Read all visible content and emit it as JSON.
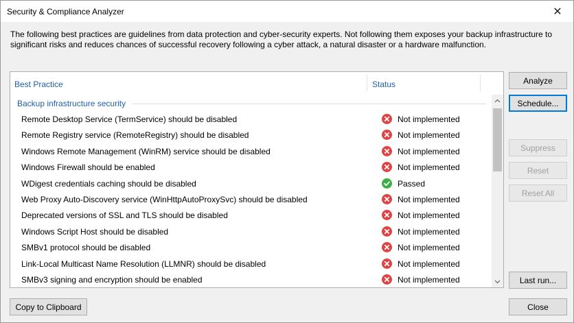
{
  "window": {
    "title": "Security & Compliance Analyzer",
    "close_glyph": "✕"
  },
  "intro": "The following best practices are guidelines from data protection and cyber-security experts. Not following them exposes your backup infrastructure to significant risks and reduces chances of successful recovery following a cyber attack, a natural disaster or a hardware malfunction.",
  "table": {
    "headers": {
      "practice": "Best Practice",
      "status": "Status"
    },
    "group": "Backup infrastructure security",
    "rows": [
      {
        "practice": "Remote Desktop Service (TermService) should be disabled",
        "status": "Not implemented",
        "icon": "error-icon"
      },
      {
        "practice": "Remote Registry service (RemoteRegistry) should be disabled",
        "status": "Not implemented",
        "icon": "error-icon"
      },
      {
        "practice": "Windows Remote Management (WinRM) service should be disabled",
        "status": "Not implemented",
        "icon": "error-icon"
      },
      {
        "practice": "Windows Firewall should be enabled",
        "status": "Not implemented",
        "icon": "error-icon"
      },
      {
        "practice": "WDigest credentials caching should be disabled",
        "status": "Passed",
        "icon": "check-icon"
      },
      {
        "practice": "Web Proxy Auto-Discovery service (WinHttpAutoProxySvc) should be disabled",
        "status": "Not implemented",
        "icon": "error-icon"
      },
      {
        "practice": "Deprecated versions of SSL and TLS should be disabled",
        "status": "Not implemented",
        "icon": "error-icon"
      },
      {
        "practice": "Windows Script Host should be disabled",
        "status": "Not implemented",
        "icon": "error-icon"
      },
      {
        "practice": "SMBv1 protocol should be disabled",
        "status": "Not implemented",
        "icon": "error-icon"
      },
      {
        "practice": "Link-Local Multicast Name Resolution (LLMNR) should be disabled",
        "status": "Not implemented",
        "icon": "error-icon"
      },
      {
        "practice": "SMBv3 signing and encryption should be enabled",
        "status": "Not implemented",
        "icon": "error-icon"
      }
    ]
  },
  "buttons": {
    "analyze": "Analyze",
    "schedule": "Schedule...",
    "suppress": "Suppress",
    "reset": "Reset",
    "reset_all": "Reset All",
    "last_run": "Last run...",
    "copy": "Copy to Clipboard",
    "close": "Close"
  },
  "colors": {
    "error": "#e04343",
    "passed": "#3fae49",
    "link_blue": "#1e5fa8"
  }
}
